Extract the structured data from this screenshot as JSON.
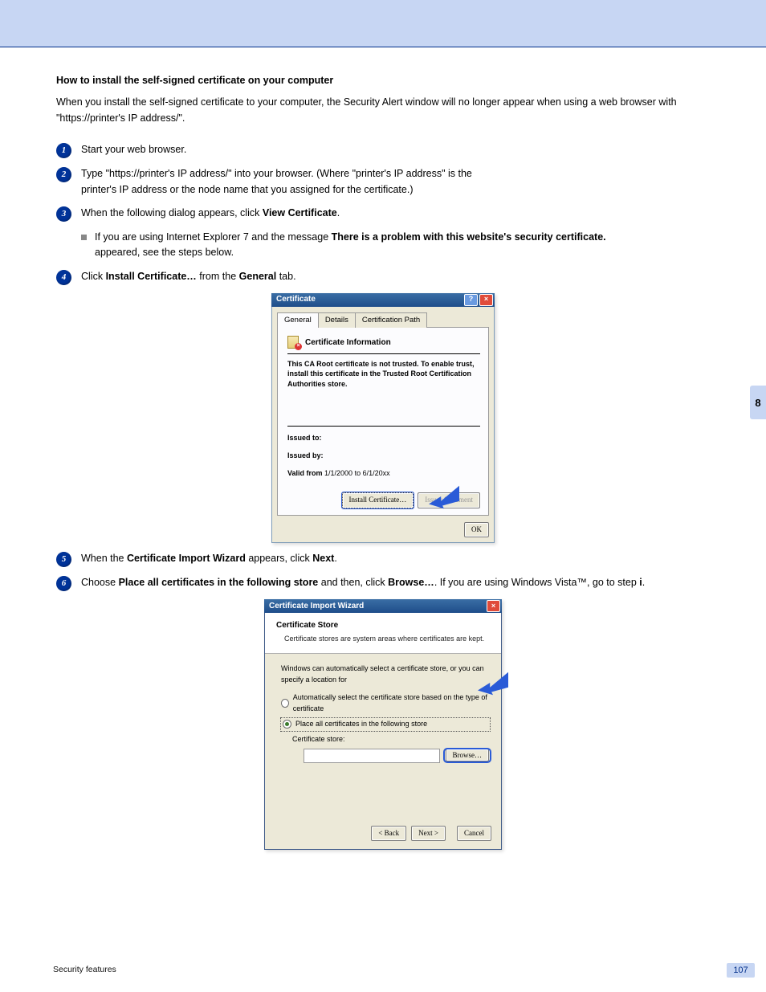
{
  "page": {
    "chapter": "8",
    "number": "107",
    "footer": "Security features"
  },
  "section": {
    "title": "How to install the self-signed certificate on your computer",
    "intro": "When you install the self-signed certificate to your computer, the Security Alert window will no longer appear when using a web browser with \"https://printer's IP address/\"."
  },
  "steps": [
    {
      "num": "1",
      "text": "Start your web browser."
    },
    {
      "num": "2",
      "text_a": "Type",
      "link": "\"https://printer's IP address/\"",
      "text_b": " into your browser. (Where \"printer's IP address\" is the",
      "line2": "printer's IP address or the node name that you assigned for the certificate.)"
    },
    {
      "num": "3",
      "text_a": "When the following dialog appears, click",
      "bold1": "View Certificate",
      "text_b": ".",
      "sub_a": "If you are using Internet Explorer 7 and the message",
      "sub_bold1": "There is a problem with this website's",
      "sub_mid": "",
      "sub_bold2": "security certificate.",
      "sub_line2": "appeared, see the steps below."
    },
    {
      "num": "4",
      "text_a": "Click",
      "bold1": "Install Certificate…",
      "text_b": "from the",
      "bold2": "General",
      "text_c": "tab."
    },
    {
      "num": "5",
      "text_a": "When the",
      "bold1": "Certificate Import Wizard",
      "text_b": "appears, click",
      "bold2": "Next",
      "text_c": "."
    },
    {
      "num": "6",
      "text_a": "Choose",
      "bold1": "Place all certificates in the following store",
      "text_b": "and then, click",
      "bold2": "Browse…",
      "text_c": ". If you are using Windows Vista™, go to step",
      "bold3": "i",
      "text_d": "."
    }
  ],
  "certDialog": {
    "title": "Certificate",
    "tabs": [
      "General",
      "Details",
      "Certification Path"
    ],
    "infoHeading": "Certificate Information",
    "trustMessage": "This CA Root certificate is not trusted. To enable trust, install this certificate in the Trusted Root Certification Authorities store.",
    "issuedToLabel": "Issued to:",
    "issuedByLabel": "Issued by:",
    "validLabel": "Valid from",
    "validValue": "1/1/2000  to  6/1/20xx",
    "installBtn": "Install Certificate…",
    "issuerBtn": "Issuer Statement",
    "okBtn": "OK"
  },
  "wizard": {
    "title": "Certificate Import Wizard",
    "heading": "Certificate Store",
    "subheading": "Certificate stores are system areas where certificates are kept.",
    "intro": "Windows can automatically select a certificate store, or you can specify a location for",
    "radioAuto": "Automatically select the certificate store based on the type of certificate",
    "radioPlace": "Place all certificates in the following store",
    "storeLabel": "Certificate store:",
    "storeValue": "",
    "browseBtn": "Browse…",
    "backBtn": "< Back",
    "nextBtn": "Next >",
    "cancelBtn": "Cancel"
  }
}
